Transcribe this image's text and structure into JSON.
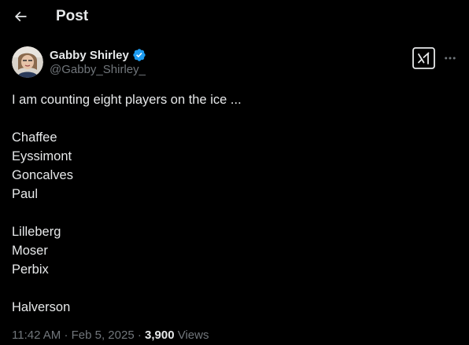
{
  "header": {
    "title": "Post",
    "back_icon": "arrow-left-icon"
  },
  "author": {
    "name": "Gabby Shirley",
    "handle": "@Gabby_Shirley_",
    "verified": true,
    "verified_color": "#1d9bf0",
    "avatar_icon": "profile-photo"
  },
  "actions": {
    "grok_icon": "grok-icon",
    "more_icon": "more-horizontal-icon"
  },
  "post": {
    "lines": [
      "I am counting eight players on the ice ...",
      "",
      "Chaffee",
      "Eyssimont",
      "Goncalves",
      "Paul",
      "",
      "Lilleberg",
      "Moser",
      "Perbix",
      "",
      "Halverson"
    ]
  },
  "meta": {
    "time": "11:42 AM",
    "separator": "·",
    "date": "Feb 5, 2025",
    "views_count": "3,900",
    "views_label": "Views"
  },
  "colors": {
    "background": "#000000",
    "text_primary": "#e7e9ea",
    "text_secondary": "#71767b",
    "accent": "#1d9bf0"
  }
}
